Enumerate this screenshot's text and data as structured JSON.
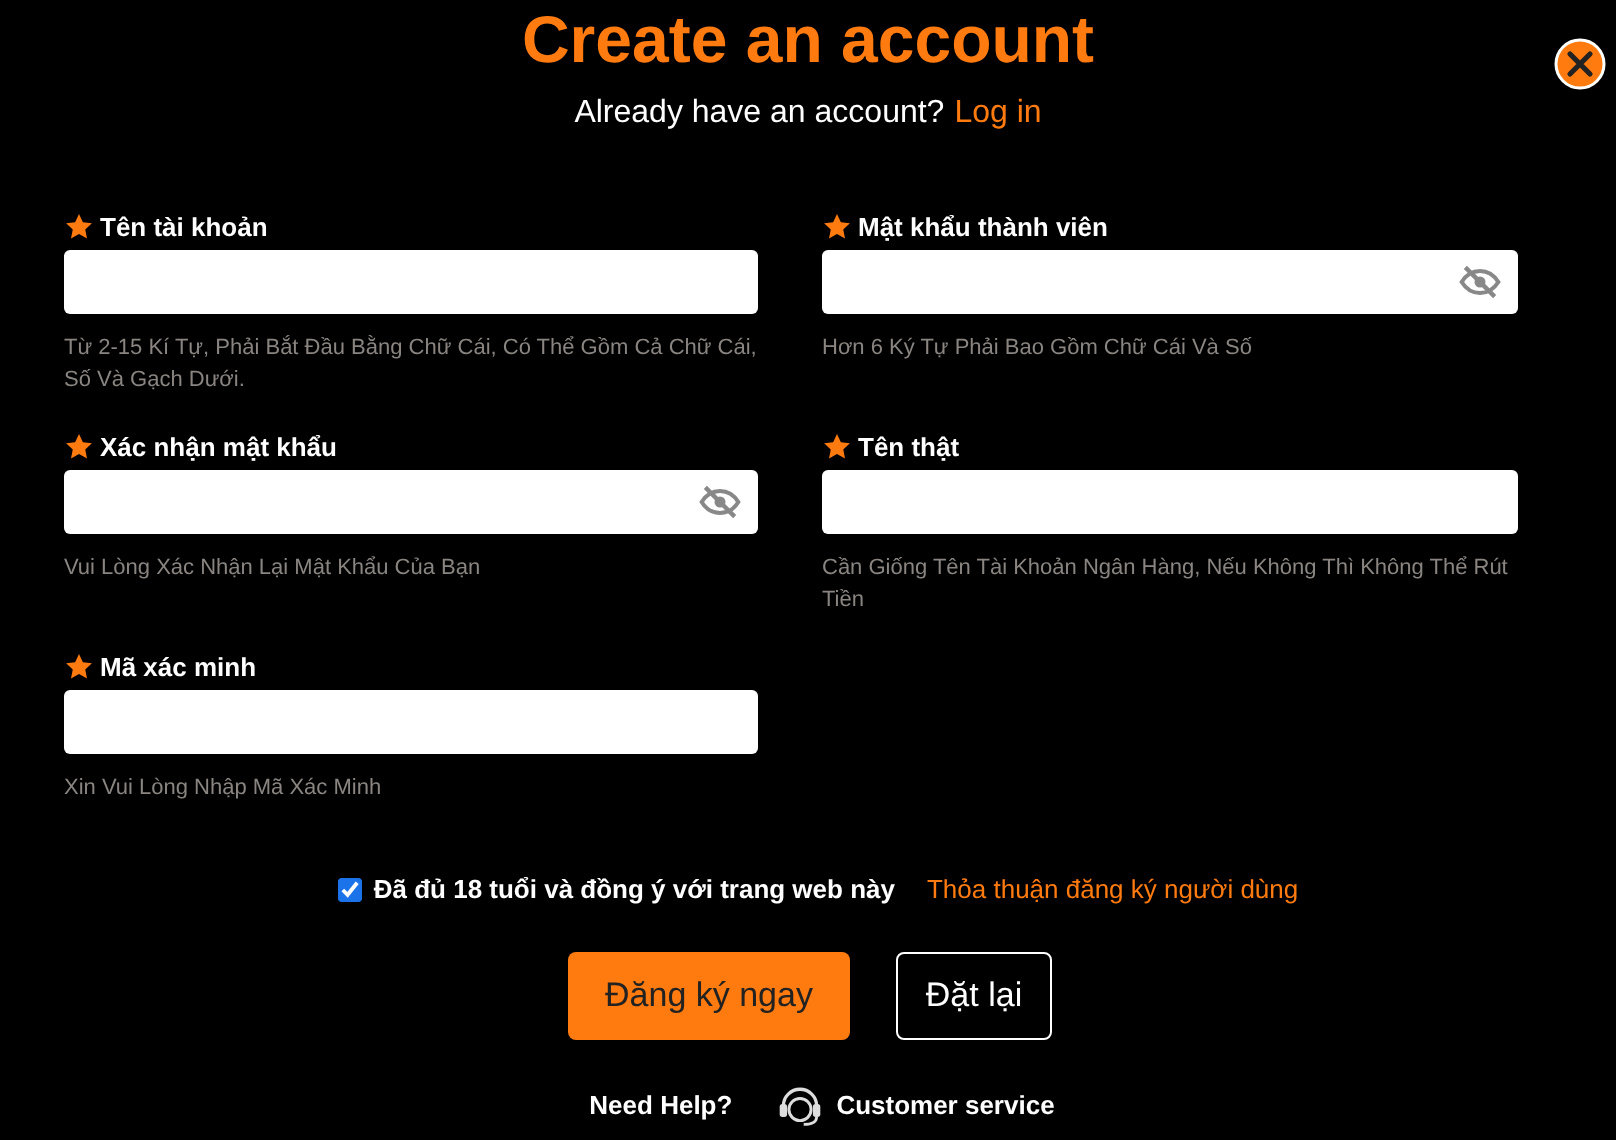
{
  "title": "Create an account",
  "login_prompt": {
    "text": "Already have an account?",
    "link": "Log in"
  },
  "fields": [
    {
      "label": "Tên tài khoản",
      "kind": "text",
      "hint": "Từ 2-15 Kí Tự, Phải Bắt Đầu Bằng Chữ Cái, Có Thể Gồm Cả Chữ Cái, Số Và Gạch Dưới."
    },
    {
      "label": "Mật khẩu thành viên",
      "kind": "password",
      "hint": "Hơn 6 Ký Tự Phải Bao Gồm Chữ Cái Và Số"
    },
    {
      "label": "Xác nhận mật khẩu",
      "kind": "password",
      "hint": "Vui Lòng Xác Nhận Lại Mật Khẩu Của Bạn"
    },
    {
      "label": "Tên thật",
      "kind": "text",
      "hint": "Cần Giống Tên Tài Khoản Ngân Hàng, Nếu Không Thì Không Thể Rút Tiền"
    },
    {
      "label": "Mã xác minh",
      "kind": "text",
      "hint": "Xin Vui Lòng Nhập Mã Xác Minh"
    }
  ],
  "agreement": {
    "checked": true,
    "text": "Đã đủ 18 tuổi và đồng ý với trang web này",
    "link": "Thỏa thuận đăng ký người dùng"
  },
  "buttons": [
    {
      "label": "Đăng ký ngay",
      "kind": "primary"
    },
    {
      "label": "Đặt lại",
      "kind": "outline"
    }
  ],
  "help": {
    "text": "Need Help?",
    "link": "Customer service"
  }
}
